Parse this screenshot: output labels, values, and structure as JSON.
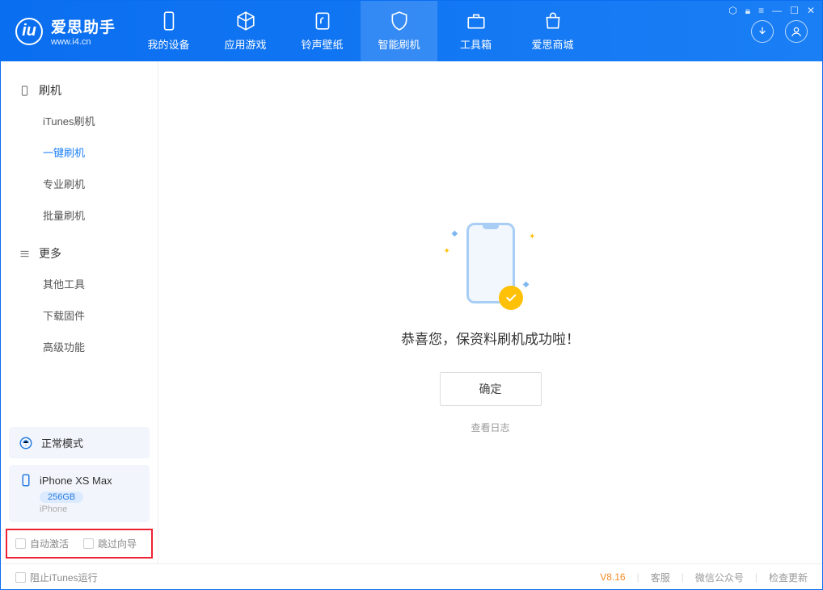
{
  "app": {
    "title": "爱思助手",
    "subtitle": "www.i4.cn"
  },
  "tabs": {
    "device": "我的设备",
    "apps": "应用游戏",
    "ring": "铃声壁纸",
    "flash": "智能刷机",
    "tools": "工具箱",
    "store": "爱思商城"
  },
  "sidebar": {
    "group1": {
      "head": "刷机",
      "items": [
        "iTunes刷机",
        "一键刷机",
        "专业刷机",
        "批量刷机"
      ]
    },
    "group2": {
      "head": "更多",
      "items": [
        "其他工具",
        "下载固件",
        "高级功能"
      ]
    }
  },
  "mode": "正常模式",
  "device": {
    "name": "iPhone XS Max",
    "storage": "256GB",
    "type": "iPhone"
  },
  "options": {
    "autoActivate": "自动激活",
    "skipGuide": "跳过向导"
  },
  "main": {
    "message": "恭喜您，保资料刷机成功啦！",
    "ok": "确定",
    "viewLog": "查看日志"
  },
  "footer": {
    "blockItunes": "阻止iTunes运行",
    "version": "V8.16",
    "support": "客服",
    "wechat": "微信公众号",
    "update": "检查更新"
  }
}
